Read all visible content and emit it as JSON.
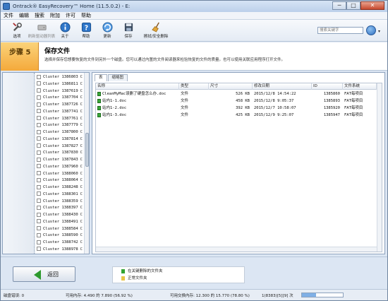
{
  "window": {
    "title": "Ontrack® EasyRecovery™ Home (11.5.0.2) - E:",
    "minimize": "─",
    "maximize": "□",
    "close": "✕"
  },
  "menu": [
    "文件",
    "编辑",
    "搜索",
    "附加",
    "许可",
    "帮助"
  ],
  "toolbar": {
    "items": [
      {
        "label": "选项",
        "icon": "wrench-icon",
        "enabled": true
      },
      {
        "label": "刷新驱动器列表",
        "icon": "refresh-drives-icon",
        "enabled": false
      },
      {
        "label": "关于",
        "icon": "info-icon",
        "enabled": true
      },
      {
        "label": "帮助",
        "icon": "help-icon",
        "enabled": true
      },
      {
        "label": "更新",
        "icon": "update-icon",
        "enabled": true
      },
      {
        "label": "保存",
        "icon": "save-icon",
        "enabled": true
      },
      {
        "label": "擦拭/安全删除",
        "icon": "broom-icon",
        "enabled": true
      }
    ],
    "search_placeholder": "搜索关键字"
  },
  "step": {
    "label": "步骤 5",
    "title": "保存文件",
    "description": "选择并保存您想要恢复的文件到另外一个磁盘。您可以通过内置的文件阅读器来检验恢复的文件的质量。也可以使用关联应用程序打开文件。"
  },
  "tree": {
    "items": [
      "Cluster 1386803",
      "Cluster 1386811",
      "Cluster 1387619",
      "Cluster 1387704",
      "Cluster 1387726",
      "Cluster 1387741",
      "Cluster 1387761",
      "Cluster 1387779",
      "Cluster 1387800",
      "Cluster 1387814",
      "Cluster 1387827",
      "Cluster 1387830",
      "Cluster 1387843",
      "Cluster 1387960",
      "Cluster 1388060",
      "Cluster 1388064",
      "Cluster 1388248",
      "Cluster 1388301",
      "Cluster 1388359",
      "Cluster 1388397",
      "Cluster 1388430",
      "Cluster 1388491",
      "Cluster 1388584",
      "Cluster 1388590",
      "Cluster 1388742",
      "Cluster 1388978"
    ],
    "trail": "C"
  },
  "file_panel": {
    "tabs": [
      "表",
      "缩略图"
    ],
    "columns": [
      "名称",
      "类型",
      "尺寸",
      "修改日期",
      "ID",
      "文件系统"
    ],
    "rows": [
      {
        "name": "CleanMyMac误删了硬盘怎么办.doc",
        "type": "文件",
        "size": "526 KB",
        "date": "2015/12/8 14:54:22",
        "id": "1385860",
        "fs": "FAT每项目"
      },
      {
        "name": "站内1-1.doc",
        "type": "文件",
        "size": "458 KB",
        "date": "2015/12/8 9:05:37",
        "id": "1385893",
        "fs": "FAT每项目"
      },
      {
        "name": "站内1-2.doc",
        "type": "文件",
        "size": "392 KB",
        "date": "2015/12/7 10:58:07",
        "id": "1385920",
        "fs": "FAT每项目"
      },
      {
        "name": "站内1-3.doc",
        "type": "文件",
        "size": "425 KB",
        "date": "2015/12/9 9:25:07",
        "id": "1385947",
        "fs": "FAT每项目"
      }
    ]
  },
  "bottom": {
    "back_label": "返回",
    "legend": [
      {
        "label": "在关键删除的文件夹",
        "color": "#33a433"
      },
      {
        "label": "正常文件夹",
        "color": "#e8c548"
      }
    ]
  },
  "status": {
    "disk_errors": "磁盘错误: 0",
    "free_memory": "可用内存: 4.490 的 7.890 (56.92 %)",
    "free_space": "可用交换内存: 12.300 的 15.770 (78.80 %)",
    "position": "1(8383)[5][9] 次",
    "progress": 0.35
  },
  "colors": {
    "accent": "#f4a93b",
    "file_icon": "#3aa83a"
  }
}
